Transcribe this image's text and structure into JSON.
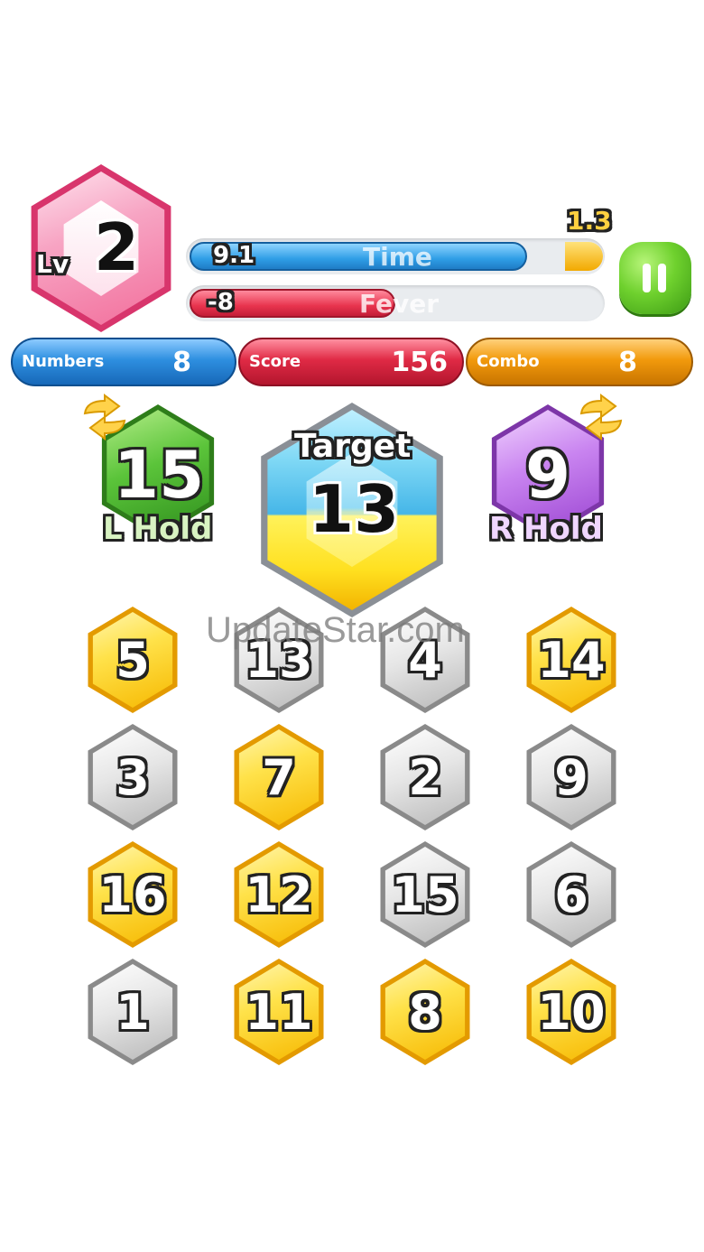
{
  "level": {
    "label": "Lv",
    "value": "2"
  },
  "time_bar": {
    "value_text": "9.1",
    "label": "Time",
    "bonus_text": "1.3",
    "fill_fraction": 0.82
  },
  "fever_bar": {
    "value_text": "-8",
    "label": "Fever",
    "fill_fraction": 0.5
  },
  "pause_button": {
    "icon": "pause-icon"
  },
  "stats": {
    "numbers": {
      "label": "Numbers",
      "value": "8"
    },
    "score": {
      "label": "Score",
      "value": "156"
    },
    "combo": {
      "label": "Combo",
      "value": "8"
    }
  },
  "left_hold": {
    "value": "15",
    "label": "L Hold",
    "icon": "swap-arrows-icon"
  },
  "target": {
    "label": "Target",
    "value": "13"
  },
  "right_hold": {
    "value": "9",
    "label": "R Hold",
    "icon": "swap-arrows-icon"
  },
  "watermark": "UpdateStar.com",
  "grid": [
    [
      {
        "value": "5",
        "color": "gold"
      },
      {
        "value": "13",
        "color": "silver"
      },
      {
        "value": "4",
        "color": "silver"
      },
      {
        "value": "14",
        "color": "gold"
      }
    ],
    [
      {
        "value": "3",
        "color": "silver"
      },
      {
        "value": "7",
        "color": "gold"
      },
      {
        "value": "2",
        "color": "silver"
      },
      {
        "value": "9",
        "color": "silver"
      }
    ],
    [
      {
        "value": "16",
        "color": "gold"
      },
      {
        "value": "12",
        "color": "gold"
      },
      {
        "value": "15",
        "color": "silver"
      },
      {
        "value": "6",
        "color": "silver"
      }
    ],
    [
      {
        "value": "1",
        "color": "silver"
      },
      {
        "value": "11",
        "color": "gold"
      },
      {
        "value": "8",
        "color": "gold"
      },
      {
        "value": "10",
        "color": "gold"
      }
    ]
  ],
  "colors": {
    "time": "#3aa7e8",
    "fever": "#e8344e",
    "numbers_pill": "#2e8fe0",
    "score_pill": "#e02a45",
    "combo_pill": "#f29a0c",
    "pause": "#55c225",
    "level_gem": "#f25c8e",
    "left_gem": "#3aa823",
    "right_gem": "#b15de0"
  }
}
